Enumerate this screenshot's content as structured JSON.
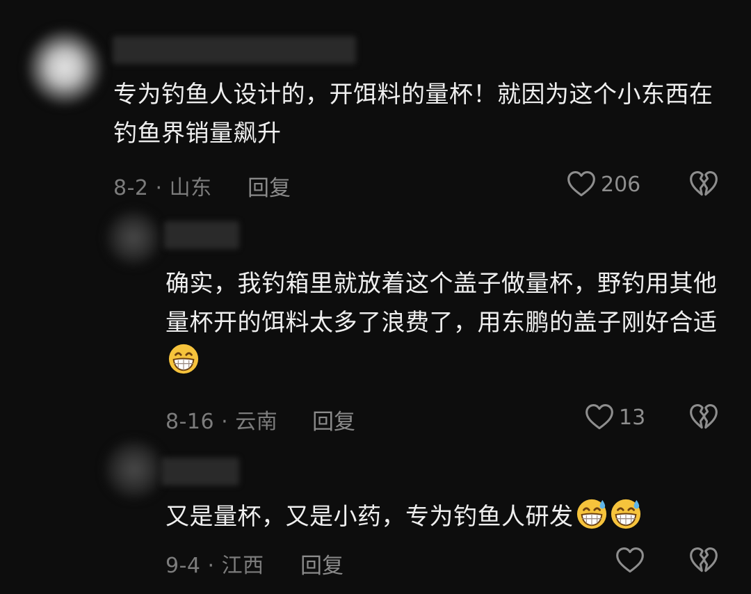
{
  "comments": [
    {
      "text": "专为钓鱼人设计的，开饵料的量杯！就因为这个小东西在钓鱼界销量飙升",
      "date_location": "8-2 · 山东",
      "reply_label": "回复",
      "like_count": "206"
    },
    {
      "text": "确实，我钓箱里就放着这个盖子做量杯，野钓用其他量杯开的饵料太多了浪费了，用东鹏的盖子刚好合适",
      "date_location": "8-16 · 云南",
      "reply_label": "回复",
      "like_count": "13",
      "emojis": [
        "grin-emoji"
      ]
    },
    {
      "text": "又是量杯，又是小药，专为钓鱼人研发",
      "date_location": "9-4 · 江西",
      "reply_label": "回复",
      "like_count": "",
      "emojis": [
        "grin-sweat-emoji",
        "grin-sweat-emoji"
      ]
    }
  ],
  "colors": {
    "background": "#0d0d0d",
    "text": "#efefef",
    "meta": "#7c7c7c",
    "icon": "#8e8e8e"
  }
}
